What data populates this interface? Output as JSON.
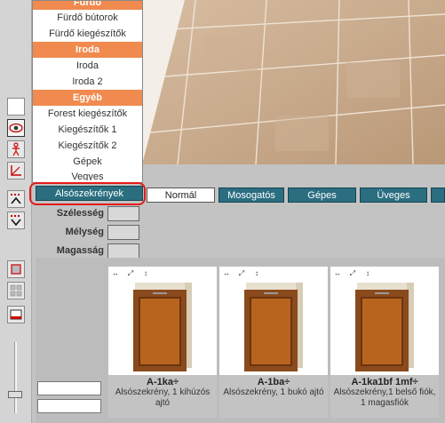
{
  "dropdown": {
    "items": [
      {
        "label": "Fürdő",
        "header": true,
        "clipped": true
      },
      {
        "label": "Fürdő bútorok"
      },
      {
        "label": "Fürdő kiegészítők"
      },
      {
        "label": "Iroda",
        "header": true
      },
      {
        "label": "Iroda"
      },
      {
        "label": "Iroda 2"
      },
      {
        "label": "Egyéb",
        "header": true
      },
      {
        "label": "Forest kiegészítők"
      },
      {
        "label": "Kiegészítők 1"
      },
      {
        "label": "Kiegészítők 2"
      },
      {
        "label": "Gépek"
      },
      {
        "label": "Vegyes"
      }
    ],
    "selected": "Alsószekrények"
  },
  "tabs": [
    {
      "label": "Normál",
      "style": "white"
    },
    {
      "label": "Mosogatós",
      "style": "teal"
    },
    {
      "label": "Gépes",
      "style": "teal"
    },
    {
      "label": "Üveges",
      "style": "teal"
    }
  ],
  "dimensions": {
    "width_label": "Szélesség",
    "depth_label": "Mélység",
    "height_label": "Magasság"
  },
  "products": [
    {
      "code": "A-1ka÷",
      "desc": "Alsószekrény, 1 kihúzós ajtó"
    },
    {
      "code": "A-1ba÷",
      "desc": "Alsószekrény, 1 bukó ajtó"
    },
    {
      "code": "A-1ka1bf 1mf÷",
      "desc": "Alsószekrény,1 belső fiók, 1 magasfiók"
    }
  ],
  "card_icons": [
    "↔",
    "⤢",
    "↕"
  ],
  "colors": {
    "header_orange": "#f08a4e",
    "tab_teal": "#2a6e80",
    "highlight_red": "#e31b1b",
    "cabinet_wood": "#8a4a1c"
  }
}
